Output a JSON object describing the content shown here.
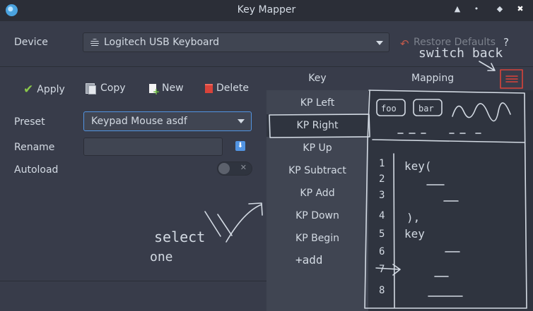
{
  "window": {
    "title": "Key Mapper",
    "controls": [
      "▲",
      "•",
      "◆",
      "✖"
    ]
  },
  "device": {
    "label": "Device",
    "selected": "Logitech USB Keyboard",
    "restore_label": "Restore Defaults",
    "help_label": "?"
  },
  "toolbar": {
    "apply": "Apply",
    "copy": "Copy",
    "new": "New",
    "delete": "Delete"
  },
  "form": {
    "preset_label": "Preset",
    "preset_value": "Keypad Mouse asdf",
    "rename_label": "Rename",
    "rename_value": "",
    "autoload_label": "Autoload",
    "autoload_on": false
  },
  "table": {
    "key_header": "Key",
    "mapping_header": "Mapping",
    "keys": [
      "KP Left",
      "KP Right",
      "KP Up",
      "KP Subtract",
      "KP Add",
      "KP Down",
      "KP Begin"
    ],
    "selected_index": 1
  },
  "annotations": {
    "switch_back": "switch back",
    "select": "select",
    "one": "one",
    "add": "+add",
    "tab1": "foo",
    "tab2": "bar",
    "code1": "key(",
    "code2": "),",
    "code3": "key",
    "line_numbers": [
      "1",
      "2",
      "3",
      "4",
      "5",
      "6",
      "7",
      "8"
    ]
  },
  "colors": {
    "accent": "#5294e2",
    "scribble_red": "#d9433a"
  }
}
